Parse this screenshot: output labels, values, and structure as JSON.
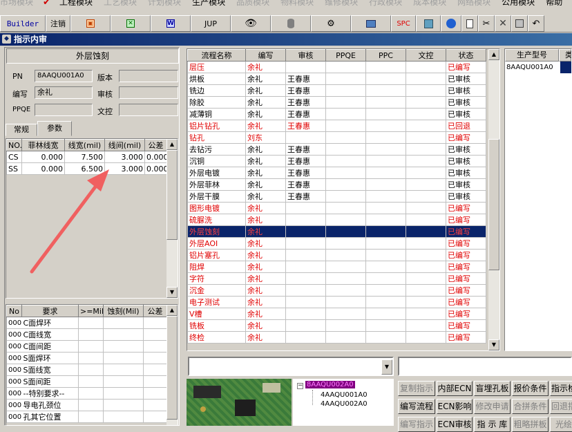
{
  "menu": {
    "items": [
      "市场模块",
      "工程模块",
      "工艺模块",
      "计划模块",
      "生产模块",
      "品质模块",
      "物料模块",
      "维修模块",
      "行政模块",
      "成本模块",
      "网络模块",
      "公用模块",
      "帮助"
    ]
  },
  "toolbar": {
    "builder": "Builder",
    "logout": "注销",
    "jup": "JUP",
    "spc": "SPC"
  },
  "window": {
    "title": "指示内审"
  },
  "left": {
    "header": "外层蚀刻",
    "pn_label": "PN",
    "pn_value": "8AAQU001A0",
    "version_label": "版本",
    "version_value": "",
    "author_label": "编写",
    "author_value": "余礼",
    "review_label": "审核",
    "review_value": "",
    "ppqe_label": "PPQE",
    "ppqe_value": "",
    "doc_label": "文控",
    "doc_value": "",
    "tabs": [
      "常规",
      "参数"
    ],
    "param_headers": [
      "NO.",
      "菲林线宽",
      "线宽(mil)",
      "线间(mil)",
      "公差"
    ],
    "param_rows": [
      [
        "CS",
        "0.000",
        "7.500",
        "3.000",
        "0.000"
      ],
      [
        "SS",
        "0.000",
        "6.500",
        "3.000",
        "0.000"
      ]
    ],
    "req_headers": [
      "No",
      "要求",
      ">=Mil",
      "蚀刻(Mil)",
      "公差"
    ],
    "req_rows": [
      [
        "000",
        "C面焊环"
      ],
      [
        "000",
        "C面线宽"
      ],
      [
        "000",
        "C面间距"
      ],
      [
        "000",
        "S面焊环"
      ],
      [
        "000",
        "S面线宽"
      ],
      [
        "000",
        "S面间距"
      ],
      [
        "000",
        "--特别要求--"
      ],
      [
        "000",
        "导电孔颈位"
      ],
      [
        "000",
        "孔其它位置"
      ]
    ]
  },
  "flow": {
    "headers": [
      "流程名称",
      "编写",
      "审核",
      "PPQE",
      "PPC",
      "文控",
      "状态"
    ],
    "rows": [
      {
        "name": "层压",
        "author": "余礼",
        "reviewer": "",
        "status": "已编写",
        "red": true
      },
      {
        "name": "烘板",
        "author": "余礼",
        "reviewer": "王春惠",
        "status": "已审核",
        "red": false
      },
      {
        "name": "铣边",
        "author": "余礼",
        "reviewer": "王春惠",
        "status": "已审核",
        "red": false
      },
      {
        "name": "除胶",
        "author": "余礼",
        "reviewer": "王春惠",
        "status": "已审核",
        "red": false
      },
      {
        "name": "减薄铜",
        "author": "余礼",
        "reviewer": "王春惠",
        "status": "已审核",
        "red": false
      },
      {
        "name": "铝片钻孔",
        "author": "余礼",
        "reviewer": "王春惠",
        "status": "已回退",
        "red": true
      },
      {
        "name": "钻孔",
        "author": "刘东",
        "reviewer": "",
        "status": "已编写",
        "red": true
      },
      {
        "name": "去钻污",
        "author": "余礼",
        "reviewer": "王春惠",
        "status": "已审核",
        "red": false
      },
      {
        "name": "沉铜",
        "author": "余礼",
        "reviewer": "王春惠",
        "status": "已审核",
        "red": false
      },
      {
        "name": "外层电镀",
        "author": "余礼",
        "reviewer": "王春惠",
        "status": "已审核",
        "red": false
      },
      {
        "name": "外层菲林",
        "author": "余礼",
        "reviewer": "王春惠",
        "status": "已审核",
        "red": false
      },
      {
        "name": "外层干膜",
        "author": "余礼",
        "reviewer": "王春惠",
        "status": "已审核",
        "red": false
      },
      {
        "name": "图形电镀",
        "author": "余礼",
        "reviewer": "",
        "status": "已编写",
        "red": true
      },
      {
        "name": "硫脲洗",
        "author": "余礼",
        "reviewer": "",
        "status": "已编写",
        "red": true
      },
      {
        "name": "外层蚀刻",
        "author": "余礼",
        "reviewer": "",
        "status": "已编写",
        "red": true,
        "selected": true
      },
      {
        "name": "外层AOI",
        "author": "余礼",
        "reviewer": "",
        "status": "已编写",
        "red": true
      },
      {
        "name": "铝片塞孔",
        "author": "余礼",
        "reviewer": "",
        "status": "已编写",
        "red": true
      },
      {
        "name": "阻焊",
        "author": "余礼",
        "reviewer": "",
        "status": "已编写",
        "red": true
      },
      {
        "name": "字符",
        "author": "余礼",
        "reviewer": "",
        "status": "已编写",
        "red": true
      },
      {
        "name": "沉金",
        "author": "余礼",
        "reviewer": "",
        "status": "已编写",
        "red": true
      },
      {
        "name": "电子测试",
        "author": "余礼",
        "reviewer": "",
        "status": "已编写",
        "red": true
      },
      {
        "name": "V槽",
        "author": "余礼",
        "reviewer": "",
        "status": "已编写",
        "red": true
      },
      {
        "name": "铣板",
        "author": "余礼",
        "reviewer": "",
        "status": "已编写",
        "red": true
      },
      {
        "name": "终检",
        "author": "余礼",
        "reviewer": "",
        "status": "已编写",
        "red": true
      }
    ]
  },
  "right": {
    "header": "生产型号",
    "header2": "类",
    "item": "8AAQU001A0"
  },
  "tree": {
    "root": "8AAQU002A0",
    "children": [
      "4AAQU001A0",
      "4AAQU002A0"
    ]
  },
  "actions": [
    {
      "label": "复制指示",
      "disabled": true
    },
    {
      "label": "内部ECN",
      "disabled": false
    },
    {
      "label": "盲埋孔板",
      "disabled": false
    },
    {
      "label": "报价条件",
      "disabled": false
    },
    {
      "label": "指示检",
      "disabled": false
    },
    {
      "label": "编写流程",
      "disabled": false
    },
    {
      "label": "ECN影响",
      "disabled": false
    },
    {
      "label": "修改申请",
      "disabled": true
    },
    {
      "label": "合拼条件",
      "disabled": true
    },
    {
      "label": "回退指",
      "disabled": true
    },
    {
      "label": "编写指示",
      "disabled": true
    },
    {
      "label": "ECN审核",
      "disabled": false
    },
    {
      "label": "指 示 库",
      "disabled": false
    },
    {
      "label": "粗略拼板",
      "disabled": true
    },
    {
      "label": "光绘",
      "disabled": true
    }
  ]
}
